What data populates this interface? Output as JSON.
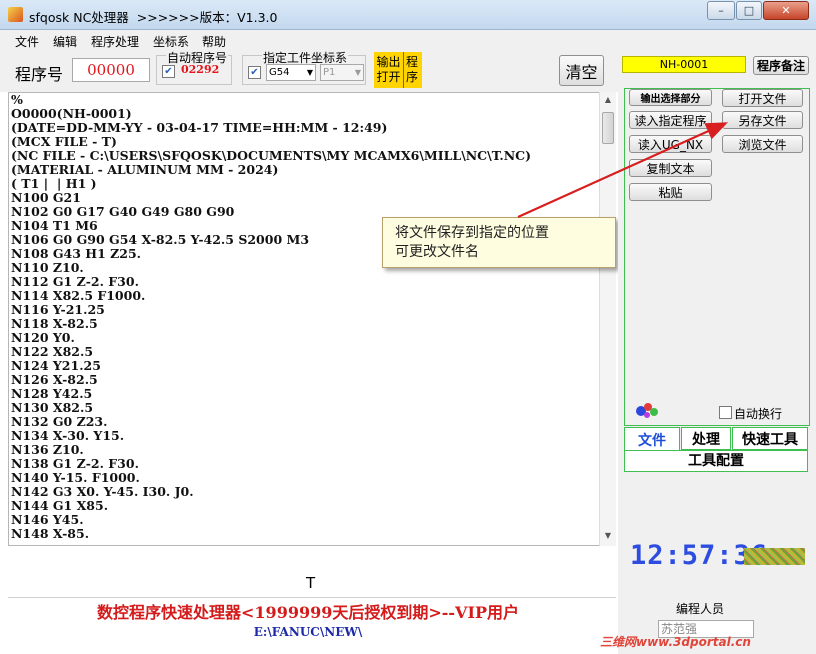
{
  "window": {
    "title": "sfqosk NC处理器  >>>>>>版本：V1.3.0",
    "minimize_glyph": "–",
    "maximize_glyph": "□",
    "close_glyph": "✕"
  },
  "menu": [
    "文件",
    "编辑",
    "程序处理",
    "坐标系",
    "帮助"
  ],
  "toolbar": {
    "program_label": "程序号",
    "program_value": "00000",
    "auto_program_label": "自动程序号",
    "auto_program_checked": "✔",
    "auto_program_value": "02292",
    "workpiece_label": "指定工件坐标系",
    "workpiece_checked": "✔",
    "workpiece_value": "G54",
    "p_value": "P1",
    "output_open_line1": "输出",
    "output_open_line2": "打开",
    "program_vert_line1": "程",
    "program_vert_line2": "序",
    "clear_label": "清空"
  },
  "editor": {
    "lines": [
      "%",
      "O0000(NH-0001)",
      "(DATE=DD-MM-YY - 03-04-17 TIME=HH:MM - 12:49)",
      "(MCX FILE - T)",
      "(NC FILE - C:\\USERS\\SFQOSK\\DOCUMENTS\\MY MCAMX6\\MILL\\NC\\T.NC)",
      "(MATERIAL - ALUMINUM MM - 2024)",
      "( T1 |  | H1 )",
      "N100 G21",
      "N102 G0 G17 G40 G49 G80 G90",
      "N104 T1 M6",
      "N106 G0 G90 G54 X-82.5 Y-42.5 S2000 M3",
      "N108 G43 H1 Z25.",
      "N110 Z10.",
      "N112 G1 Z-2. F30.",
      "N114 X82.5 F1000.",
      "N116 Y-21.25",
      "N118 X-82.5",
      "N120 Y0.",
      "N122 X82.5",
      "N124 Y21.25",
      "N126 X-82.5",
      "N128 Y42.5",
      "N130 X82.5",
      "N132 G0 Z23.",
      "N134 X-30. Y15.",
      "N136 Z10.",
      "N138 G1 Z-2. F30.",
      "N140 Y-15. F1000.",
      "N142 G3 X0. Y-45. I30. J0.",
      "N144 G1 X85.",
      "N146 Y45.",
      "N148 X-85."
    ],
    "scroll_up": "▲",
    "scroll_down": "▼"
  },
  "callout": {
    "line1": "将文件保存到指定的位置",
    "line2": "可更改文件名"
  },
  "bottom": {
    "letter": "T",
    "license_text": "数控程序快速处理器<1999999天后授权到期>--VIP用户",
    "path_text": "E:\\FANUC\\NEW\\"
  },
  "right": {
    "program_name": "NH-0001",
    "program_note_label": "程序备注",
    "buttons_left": [
      "输出选择部分",
      "读入指定程序",
      "读入UG_NX",
      "复制文本",
      "粘贴"
    ],
    "buttons_right": [
      "打开文件",
      "另存文件",
      "浏览文件"
    ],
    "auto_wrap_label": "自动换行",
    "tabs": [
      "文件",
      "处理",
      "快速工具"
    ],
    "tool_config_label": "工具配置",
    "clock": "12:57:36",
    "programmer_label": "编程人员",
    "programmer_value": "苏范强",
    "watermark": "三维网www.3dportal.cn"
  },
  "colors": {
    "program_name_bg": "#ffff00",
    "output_btn_bg": "#ffd400",
    "tab_border": "#3fbf52",
    "status_red": "#d41a1a",
    "path_blue": "#1d2aa8",
    "clock_blue": "#2c4de0",
    "arrow_red": "#d81e1e"
  }
}
